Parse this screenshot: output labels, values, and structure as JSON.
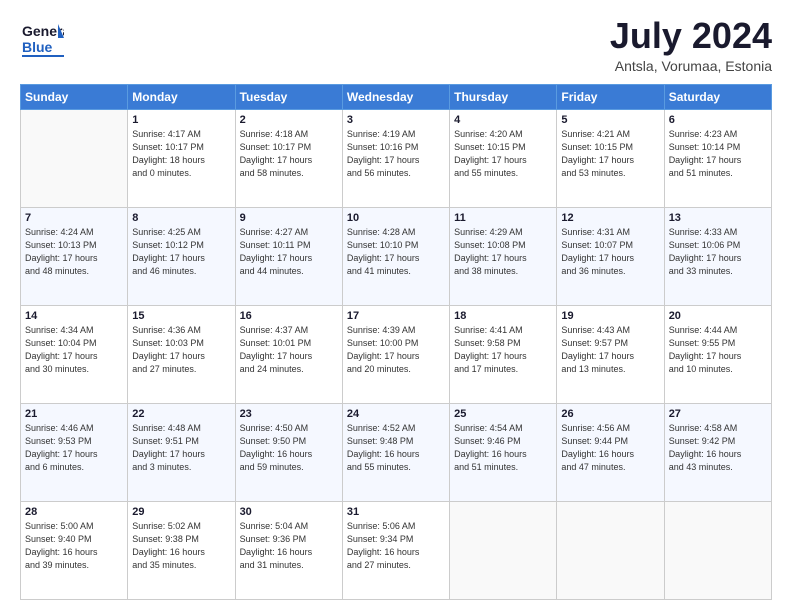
{
  "header": {
    "logo_top": "General",
    "logo_bottom": "Blue",
    "title": "July 2024",
    "subtitle": "Antsla, Vorumaa, Estonia"
  },
  "calendar": {
    "days_of_week": [
      "Sunday",
      "Monday",
      "Tuesday",
      "Wednesday",
      "Thursday",
      "Friday",
      "Saturday"
    ],
    "weeks": [
      [
        {
          "day": "",
          "info": ""
        },
        {
          "day": "1",
          "info": "Sunrise: 4:17 AM\nSunset: 10:17 PM\nDaylight: 18 hours\nand 0 minutes."
        },
        {
          "day": "2",
          "info": "Sunrise: 4:18 AM\nSunset: 10:17 PM\nDaylight: 17 hours\nand 58 minutes."
        },
        {
          "day": "3",
          "info": "Sunrise: 4:19 AM\nSunset: 10:16 PM\nDaylight: 17 hours\nand 56 minutes."
        },
        {
          "day": "4",
          "info": "Sunrise: 4:20 AM\nSunset: 10:15 PM\nDaylight: 17 hours\nand 55 minutes."
        },
        {
          "day": "5",
          "info": "Sunrise: 4:21 AM\nSunset: 10:15 PM\nDaylight: 17 hours\nand 53 minutes."
        },
        {
          "day": "6",
          "info": "Sunrise: 4:23 AM\nSunset: 10:14 PM\nDaylight: 17 hours\nand 51 minutes."
        }
      ],
      [
        {
          "day": "7",
          "info": "Sunrise: 4:24 AM\nSunset: 10:13 PM\nDaylight: 17 hours\nand 48 minutes."
        },
        {
          "day": "8",
          "info": "Sunrise: 4:25 AM\nSunset: 10:12 PM\nDaylight: 17 hours\nand 46 minutes."
        },
        {
          "day": "9",
          "info": "Sunrise: 4:27 AM\nSunset: 10:11 PM\nDaylight: 17 hours\nand 44 minutes."
        },
        {
          "day": "10",
          "info": "Sunrise: 4:28 AM\nSunset: 10:10 PM\nDaylight: 17 hours\nand 41 minutes."
        },
        {
          "day": "11",
          "info": "Sunrise: 4:29 AM\nSunset: 10:08 PM\nDaylight: 17 hours\nand 38 minutes."
        },
        {
          "day": "12",
          "info": "Sunrise: 4:31 AM\nSunset: 10:07 PM\nDaylight: 17 hours\nand 36 minutes."
        },
        {
          "day": "13",
          "info": "Sunrise: 4:33 AM\nSunset: 10:06 PM\nDaylight: 17 hours\nand 33 minutes."
        }
      ],
      [
        {
          "day": "14",
          "info": "Sunrise: 4:34 AM\nSunset: 10:04 PM\nDaylight: 17 hours\nand 30 minutes."
        },
        {
          "day": "15",
          "info": "Sunrise: 4:36 AM\nSunset: 10:03 PM\nDaylight: 17 hours\nand 27 minutes."
        },
        {
          "day": "16",
          "info": "Sunrise: 4:37 AM\nSunset: 10:01 PM\nDaylight: 17 hours\nand 24 minutes."
        },
        {
          "day": "17",
          "info": "Sunrise: 4:39 AM\nSunset: 10:00 PM\nDaylight: 17 hours\nand 20 minutes."
        },
        {
          "day": "18",
          "info": "Sunrise: 4:41 AM\nSunset: 9:58 PM\nDaylight: 17 hours\nand 17 minutes."
        },
        {
          "day": "19",
          "info": "Sunrise: 4:43 AM\nSunset: 9:57 PM\nDaylight: 17 hours\nand 13 minutes."
        },
        {
          "day": "20",
          "info": "Sunrise: 4:44 AM\nSunset: 9:55 PM\nDaylight: 17 hours\nand 10 minutes."
        }
      ],
      [
        {
          "day": "21",
          "info": "Sunrise: 4:46 AM\nSunset: 9:53 PM\nDaylight: 17 hours\nand 6 minutes."
        },
        {
          "day": "22",
          "info": "Sunrise: 4:48 AM\nSunset: 9:51 PM\nDaylight: 17 hours\nand 3 minutes."
        },
        {
          "day": "23",
          "info": "Sunrise: 4:50 AM\nSunset: 9:50 PM\nDaylight: 16 hours\nand 59 minutes."
        },
        {
          "day": "24",
          "info": "Sunrise: 4:52 AM\nSunset: 9:48 PM\nDaylight: 16 hours\nand 55 minutes."
        },
        {
          "day": "25",
          "info": "Sunrise: 4:54 AM\nSunset: 9:46 PM\nDaylight: 16 hours\nand 51 minutes."
        },
        {
          "day": "26",
          "info": "Sunrise: 4:56 AM\nSunset: 9:44 PM\nDaylight: 16 hours\nand 47 minutes."
        },
        {
          "day": "27",
          "info": "Sunrise: 4:58 AM\nSunset: 9:42 PM\nDaylight: 16 hours\nand 43 minutes."
        }
      ],
      [
        {
          "day": "28",
          "info": "Sunrise: 5:00 AM\nSunset: 9:40 PM\nDaylight: 16 hours\nand 39 minutes."
        },
        {
          "day": "29",
          "info": "Sunrise: 5:02 AM\nSunset: 9:38 PM\nDaylight: 16 hours\nand 35 minutes."
        },
        {
          "day": "30",
          "info": "Sunrise: 5:04 AM\nSunset: 9:36 PM\nDaylight: 16 hours\nand 31 minutes."
        },
        {
          "day": "31",
          "info": "Sunrise: 5:06 AM\nSunset: 9:34 PM\nDaylight: 16 hours\nand 27 minutes."
        },
        {
          "day": "",
          "info": ""
        },
        {
          "day": "",
          "info": ""
        },
        {
          "day": "",
          "info": ""
        }
      ]
    ]
  }
}
